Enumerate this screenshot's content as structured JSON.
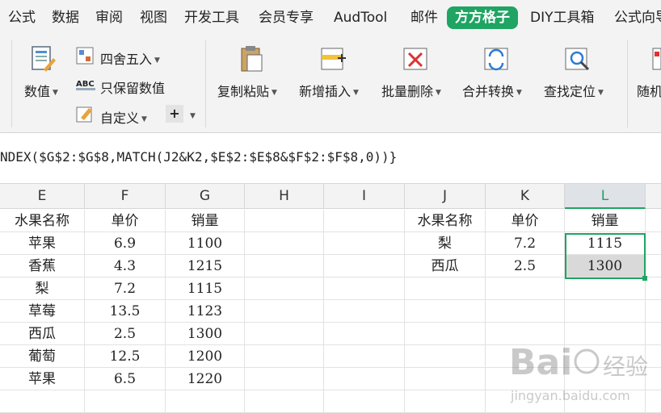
{
  "menu": {
    "tabs": [
      {
        "label": "公式"
      },
      {
        "label": "数据"
      },
      {
        "label": "审阅"
      },
      {
        "label": "视图"
      },
      {
        "label": "开发工具"
      },
      {
        "label": "会员专享"
      },
      {
        "label": "AudTool"
      },
      {
        "label": "邮件"
      },
      {
        "label": "方方格子"
      },
      {
        "label": "DIY工具箱"
      },
      {
        "label": "公式向导"
      }
    ]
  },
  "ribbon": {
    "numeric_label": "数值",
    "round_label": "四舍五入",
    "keep_value_label": "只保留数值",
    "custom_label": "自定义",
    "plus_label": "+",
    "copy_paste_label": "复制粘贴",
    "insert_label": "新增插入",
    "batch_delete_label": "批量删除",
    "merge_label": "合并转换",
    "find_label": "查找定位",
    "random_label": "随机"
  },
  "formula_bar": {
    "text": "NDEX($G$2:$G$8,MATCH(J2&K2,$E$2:$E$8&$F$2:$F$8,0))}"
  },
  "grid": {
    "columns": [
      "E",
      "F",
      "G",
      "H",
      "I",
      "J",
      "K",
      "L"
    ],
    "rows": [
      [
        "水果名称",
        "单价",
        "销量",
        "",
        "",
        "水果名称",
        "单价",
        "销量"
      ],
      [
        "苹果",
        "6.9",
        "1100",
        "",
        "",
        "梨",
        "7.2",
        "1115"
      ],
      [
        "香蕉",
        "4.3",
        "1215",
        "",
        "",
        "西瓜",
        "2.5",
        "1300"
      ],
      [
        "梨",
        "7.2",
        "1115",
        "",
        "",
        "",
        "",
        ""
      ],
      [
        "草莓",
        "13.5",
        "1123",
        "",
        "",
        "",
        "",
        ""
      ],
      [
        "西瓜",
        "2.5",
        "1300",
        "",
        "",
        "",
        "",
        ""
      ],
      [
        "葡萄",
        "12.5",
        "1200",
        "",
        "",
        "",
        "",
        ""
      ],
      [
        "苹果",
        "6.5",
        "1220",
        "",
        "",
        "",
        "",
        ""
      ]
    ]
  },
  "watermark": {
    "brand": "Bai",
    "brand2": "经验",
    "url": "jingyan.baidu.com"
  },
  "colors": {
    "accent": "#1fa463"
  }
}
